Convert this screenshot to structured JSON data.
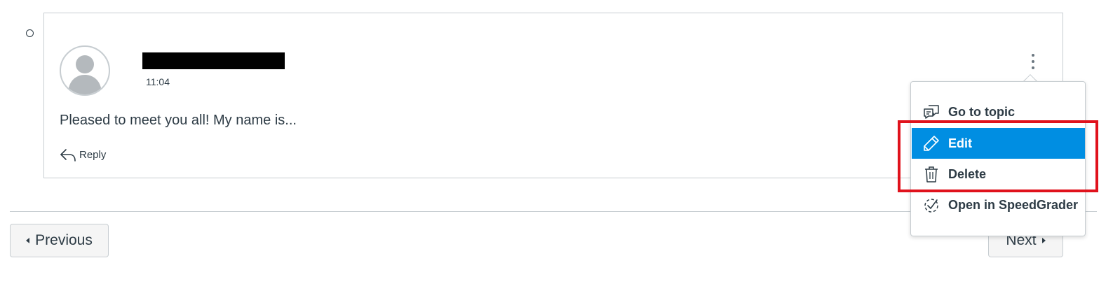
{
  "entry": {
    "timestamp": "11:04",
    "message": "Pleased to meet you all! My name is...",
    "reply_label": "Reply"
  },
  "menu": {
    "items": [
      {
        "label": "Go to topic",
        "icon": "discussion-icon"
      },
      {
        "label": "Edit",
        "icon": "pencil-icon",
        "active": true
      },
      {
        "label": "Delete",
        "icon": "trash-icon"
      },
      {
        "label": "Open in SpeedGrader",
        "icon": "speedgrader-icon"
      }
    ]
  },
  "pagination": {
    "previous_label": "Previous",
    "next_label": "Next"
  },
  "colors": {
    "accent": "#008ee2",
    "highlight": "#e0121c",
    "text": "#2d3b45",
    "border": "#c7cdd1"
  }
}
